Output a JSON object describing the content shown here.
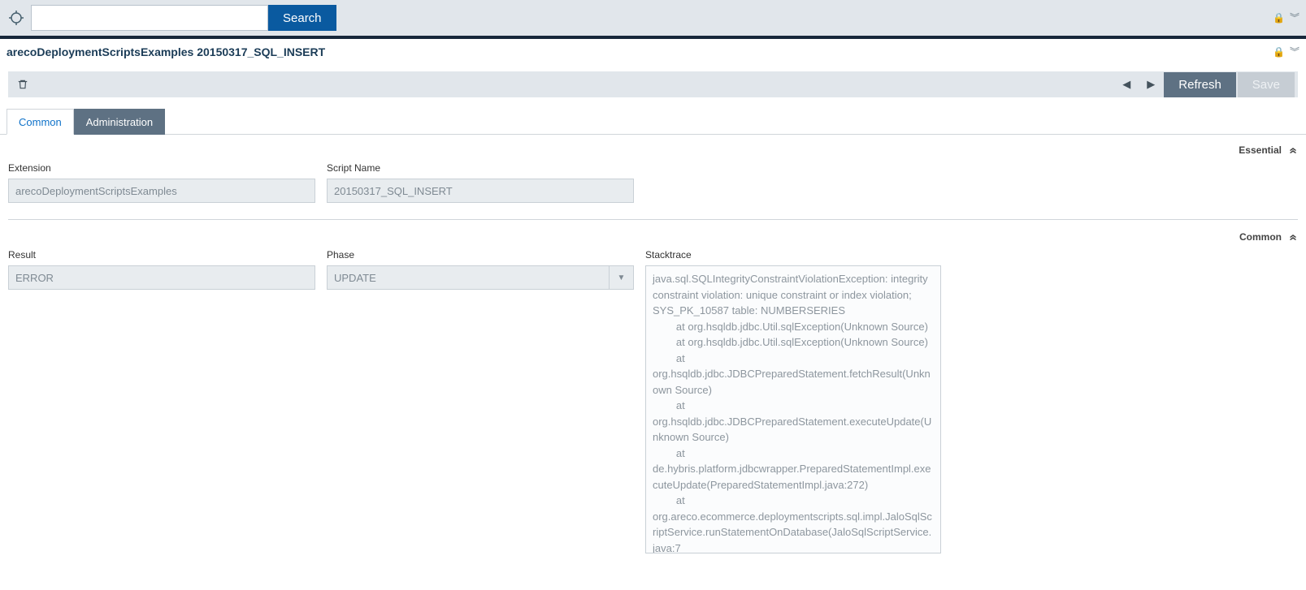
{
  "topbar": {
    "search_value": "",
    "search_button": "Search"
  },
  "titlebar": {
    "title": "arecoDeploymentScriptsExamples 20150317_SQL_INSERT"
  },
  "toolbar": {
    "refresh": "Refresh",
    "save": "Save"
  },
  "tabs": {
    "common": "Common",
    "administration": "Administration"
  },
  "sections": {
    "essential": "Essential",
    "common": "Common"
  },
  "fields": {
    "extension_label": "Extension",
    "extension_value": "arecoDeploymentScriptsExamples",
    "scriptname_label": "Script Name",
    "scriptname_value": "20150317_SQL_INSERT",
    "result_label": "Result",
    "result_value": "ERROR",
    "phase_label": "Phase",
    "phase_value": "UPDATE",
    "stacktrace_label": "Stacktrace",
    "stacktrace_value": "java.sql.SQLIntegrityConstraintViolationException: integrity constraint violation: unique constraint or index violation; SYS_PK_10587 table: NUMBERSERIES\n        at org.hsqldb.jdbc.Util.sqlException(Unknown Source)\n        at org.hsqldb.jdbc.Util.sqlException(Unknown Source)\n        at org.hsqldb.jdbc.JDBCPreparedStatement.fetchResult(Unknown Source)\n        at org.hsqldb.jdbc.JDBCPreparedStatement.executeUpdate(Unknown Source)\n        at de.hybris.platform.jdbcwrapper.PreparedStatementImpl.executeUpdate(PreparedStatementImpl.java:272)\n        at org.areco.ecommerce.deploymentscripts.sql.impl.JaloSqlScriptService.runStatementOnDatabase(JaloSqlScriptService.java:7"
  }
}
